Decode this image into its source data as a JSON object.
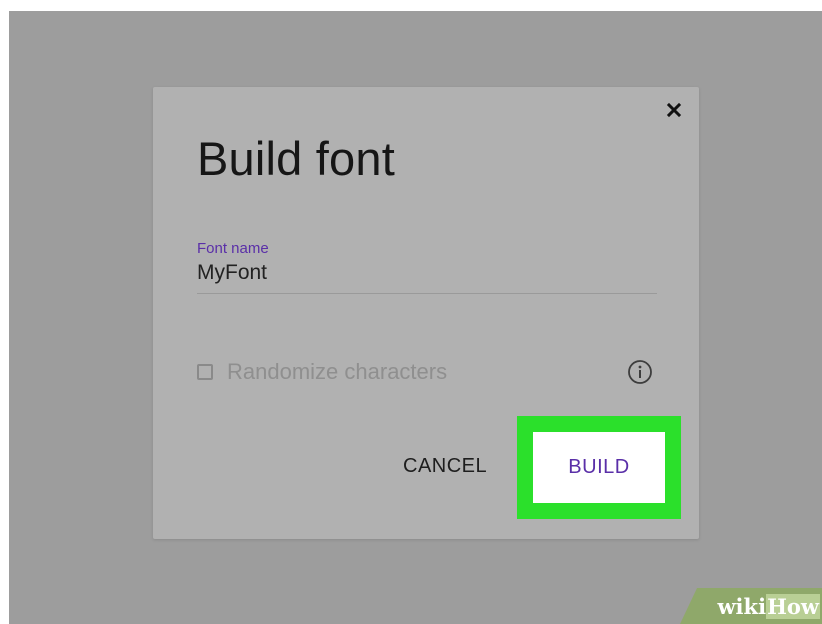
{
  "dialog": {
    "title": "Build font",
    "close_icon": "close-icon",
    "font_name_label": "Font name",
    "font_name_value": "MyFont",
    "randomize_label": "Randomize characters",
    "randomize_checked": false,
    "info_icon": "info-icon",
    "cancel_label": "CANCEL",
    "build_label": "BUILD"
  },
  "watermark": {
    "part1": "wiki",
    "part2": "How"
  },
  "colors": {
    "backdrop": "#9d9d9d",
    "dialog_bg": "#b1b1b1",
    "accent": "#5a2fa8",
    "highlight": "#2be02b"
  }
}
